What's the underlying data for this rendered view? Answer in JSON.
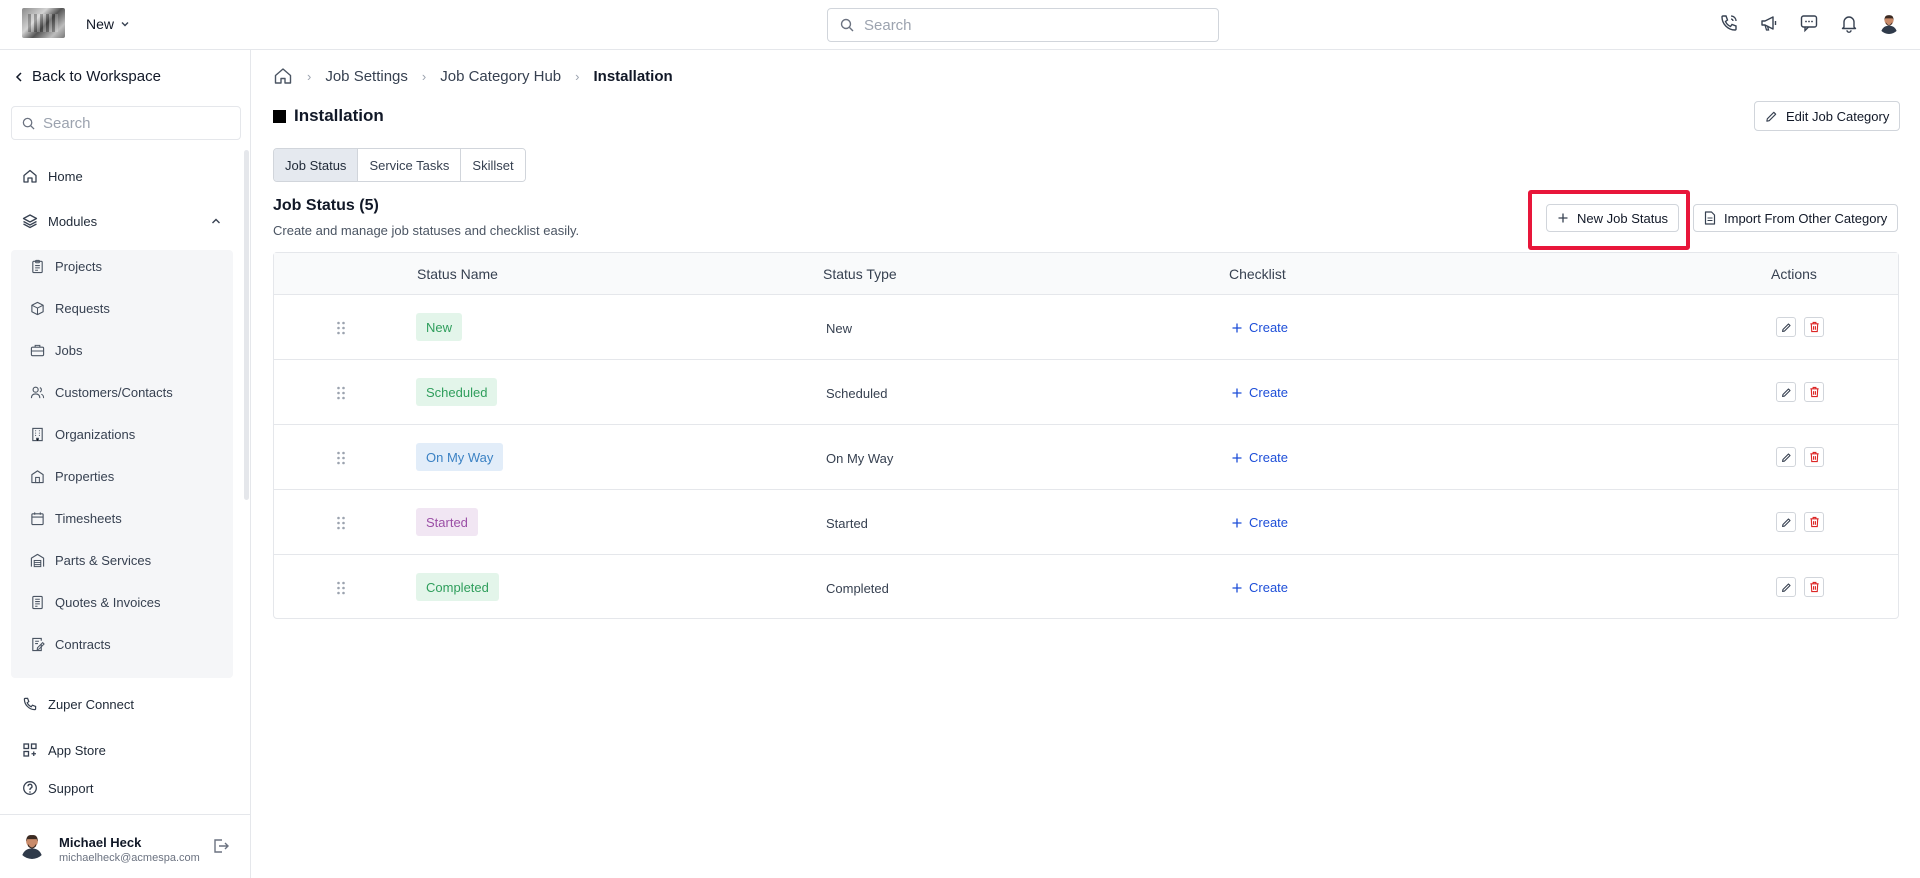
{
  "topbar": {
    "workspace_label": "New",
    "search_placeholder": "Search"
  },
  "sidebar": {
    "back_label": "Back to Workspace",
    "search_placeholder": "Search",
    "home_label": "Home",
    "modules_label": "Modules",
    "modules_items": [
      {
        "label": "Projects",
        "icon": "clipboard-icon"
      },
      {
        "label": "Requests",
        "icon": "box-icon"
      },
      {
        "label": "Jobs",
        "icon": "briefcase-icon"
      },
      {
        "label": "Customers/Contacts",
        "icon": "users-icon"
      },
      {
        "label": "Organizations",
        "icon": "building-icon"
      },
      {
        "label": "Properties",
        "icon": "house-icon"
      },
      {
        "label": "Timesheets",
        "icon": "calendar-icon"
      },
      {
        "label": "Parts & Services",
        "icon": "warehouse-icon"
      },
      {
        "label": "Quotes & Invoices",
        "icon": "invoice-icon"
      },
      {
        "label": "Contracts",
        "icon": "contract-icon"
      }
    ],
    "connect_label": "Zuper Connect",
    "appstore_label": "App Store",
    "support_label": "Support",
    "user": {
      "name": "Michael Heck",
      "email": "michaelheck@acmespa.com"
    }
  },
  "breadcrumb": {
    "items": [
      "Job Settings",
      "Job Category Hub",
      "Installation"
    ]
  },
  "page": {
    "title": "Installation",
    "edit_button_label": "Edit Job Category",
    "tabs": [
      {
        "label": "Job Status",
        "active": true
      },
      {
        "label": "Service Tasks",
        "active": false
      },
      {
        "label": "Skillset",
        "active": false
      }
    ],
    "section_title": "Job Status (5)",
    "section_desc": "Create and manage job statuses and checklist easily.",
    "new_status_label": "New Job Status",
    "import_label": "Import From Other Category"
  },
  "table": {
    "headers": [
      "Status Name",
      "Status Type",
      "Checklist",
      "Actions"
    ],
    "rows": [
      {
        "name": "New",
        "type": "New",
        "checklist": "Create",
        "badge_bg": "#e3f5ea",
        "badge_fg": "#2f9e5c"
      },
      {
        "name": "Scheduled",
        "type": "Scheduled",
        "checklist": "Create",
        "badge_bg": "#e3f5ea",
        "badge_fg": "#2f9e5c"
      },
      {
        "name": "On My Way",
        "type": "On My Way",
        "checklist": "Create",
        "badge_bg": "#e2edf9",
        "badge_fg": "#3b82c4"
      },
      {
        "name": "Started",
        "type": "Started",
        "checklist": "Create",
        "badge_bg": "#f1e6f3",
        "badge_fg": "#9b4fa6"
      },
      {
        "name": "Completed",
        "type": "Completed",
        "checklist": "Create",
        "badge_bg": "#e3f5ea",
        "badge_fg": "#2f9e5c"
      }
    ]
  },
  "colors": {
    "highlight": "#e8163a",
    "link": "#1d4ed8",
    "danger": "#dc2626"
  }
}
